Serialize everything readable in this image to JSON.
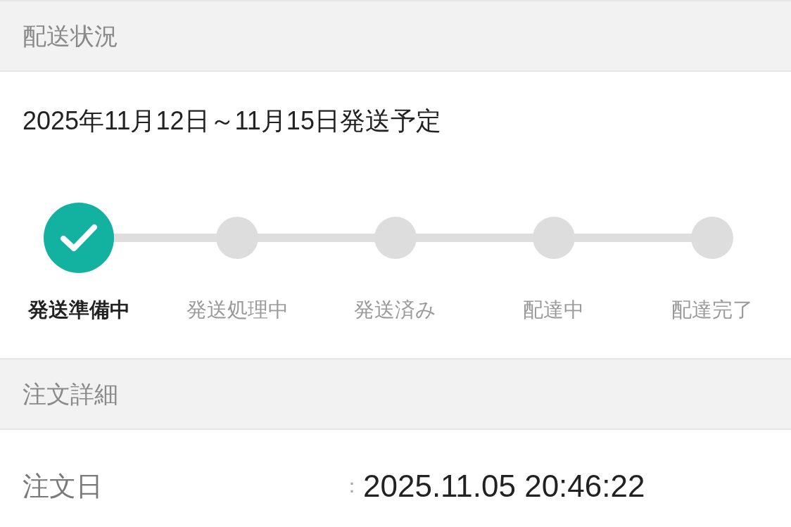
{
  "shipping_status": {
    "title": "配送状況",
    "estimate": "2025年11月12日～11月15日発送予定",
    "steps": [
      {
        "label": "発送準備中",
        "done": true
      },
      {
        "label": "発送処理中",
        "done": false
      },
      {
        "label": "発送済み",
        "done": false
      },
      {
        "label": "配達中",
        "done": false
      },
      {
        "label": "配達完了",
        "done": false
      }
    ]
  },
  "order_details": {
    "title": "注文詳細",
    "rows": [
      {
        "label": "注文日",
        "separator": "：",
        "value": "2025.11.05 20:46:22"
      }
    ]
  }
}
